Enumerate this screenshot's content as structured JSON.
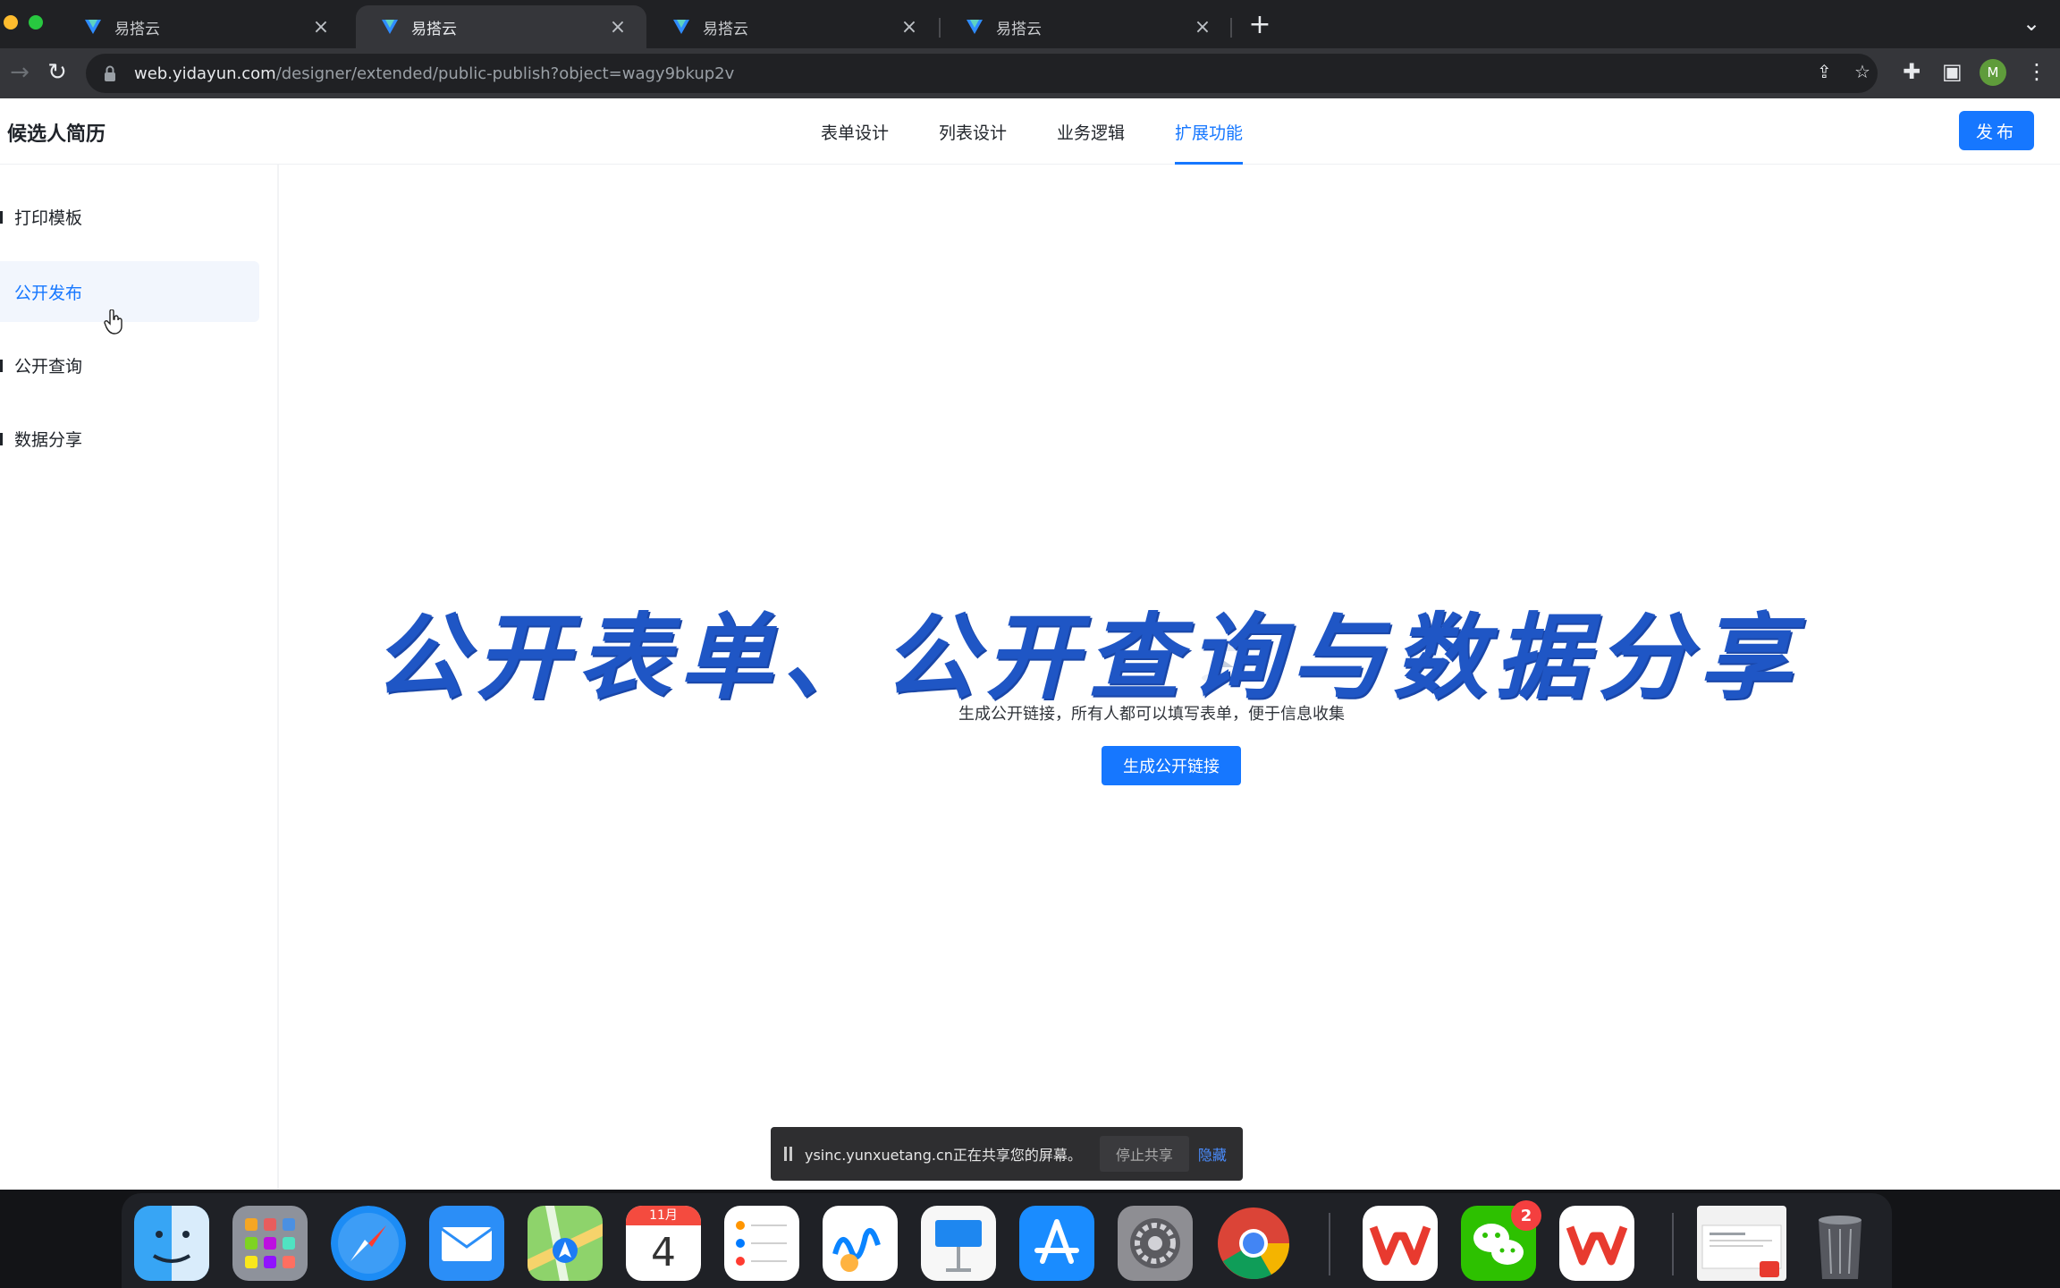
{
  "browser": {
    "tabs": [
      {
        "title": "易搭云",
        "close": "×"
      },
      {
        "title": "易搭云",
        "close": "×"
      },
      {
        "title": "易搭云",
        "close": "×"
      },
      {
        "title": "易搭云",
        "close": "×"
      }
    ],
    "active_tab": 1,
    "new_tab": "+",
    "tab_menu": "⌄",
    "url_host": "web.yidayun.com",
    "url_path": "/designer/extended/public-publish?object=wagy9bkup2v",
    "profile_initial": "M"
  },
  "app": {
    "title": "候选人简历",
    "tabs": [
      "表单设计",
      "列表设计",
      "业务逻辑",
      "扩展功能"
    ],
    "active_tab": "扩展功能",
    "publish_label": "发布"
  },
  "sidebar": {
    "items": [
      {
        "label": "打印模板"
      },
      {
        "label": "公开发布"
      },
      {
        "label": "公开查询"
      },
      {
        "label": "数据分享"
      }
    ],
    "active_item": "公开发布"
  },
  "main": {
    "overlay_title": "公开表单、公开查询与数据分享",
    "description": "生成公开链接，所有人都可以填写表单，便于信息收集",
    "generate_link_label": "生成公开链接"
  },
  "share_bar": {
    "message": "ysinc.yunxuetang.cn正在共享您的屏幕。",
    "stop_label": "停止共享",
    "hide_label": "隐藏"
  },
  "dock": {
    "calendar_month": "11月",
    "calendar_day": "4",
    "wechat_badge": "2",
    "apps": [
      "finder-icon",
      "launchpad-icon",
      "safari-icon",
      "mail-icon",
      "maps-icon",
      "calendar-icon",
      "reminders-icon",
      "freeform-icon",
      "keynote-icon",
      "app-store-icon",
      "system-settings-icon",
      "chrome-icon",
      "wps-icon",
      "wechat-icon",
      "wps-office-icon",
      "document-thumbnail-icon",
      "trash-icon"
    ]
  },
  "colors": {
    "accent": "#1677ff",
    "overlay_text": "#1f56c5",
    "chrome_dark": "#202124",
    "chrome_toolbar": "#35363a"
  }
}
